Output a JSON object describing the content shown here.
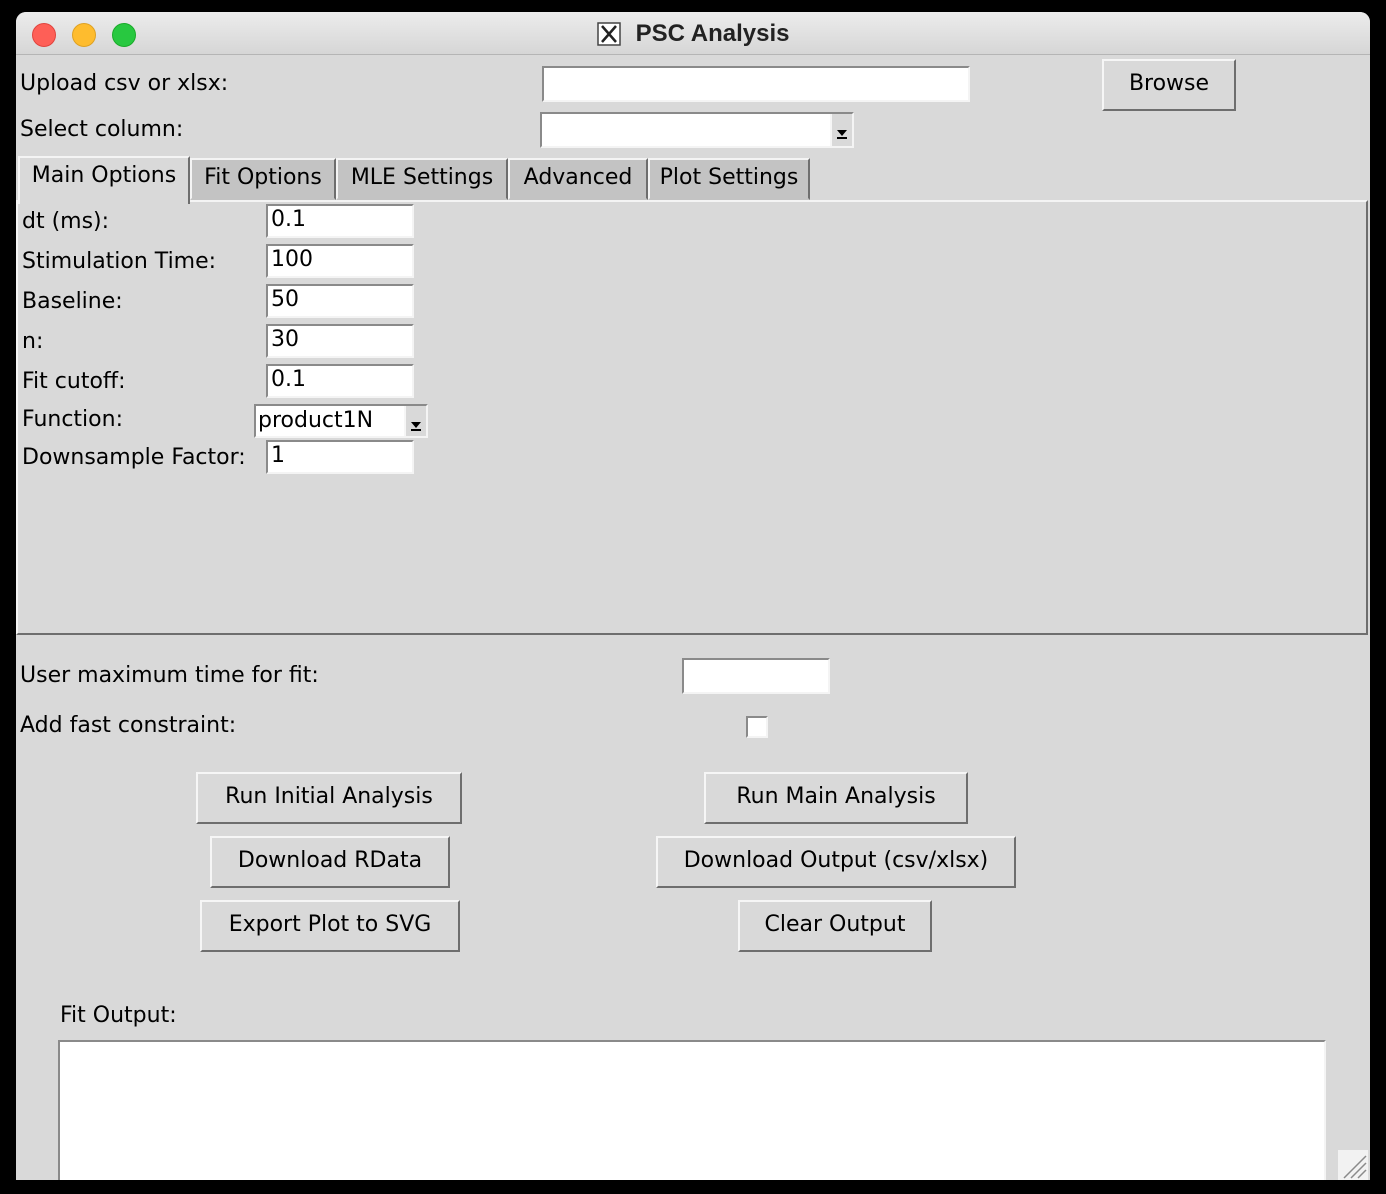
{
  "window": {
    "title": "PSC Analysis",
    "title_icon": "x11-icon"
  },
  "file": {
    "label": "Upload csv or xlsx:",
    "value": "",
    "browse_label": "Browse"
  },
  "column": {
    "label": "Select column:",
    "value": ""
  },
  "tabs": [
    {
      "label": "Main Options",
      "active": true
    },
    {
      "label": "Fit Options",
      "active": false
    },
    {
      "label": "MLE Settings",
      "active": false
    },
    {
      "label": "Advanced",
      "active": false
    },
    {
      "label": "Plot Settings",
      "active": false
    }
  ],
  "main_options": {
    "dt": {
      "label": "dt (ms):",
      "value": "0.1"
    },
    "stim_time": {
      "label": "Stimulation Time:",
      "value": "100"
    },
    "baseline": {
      "label": "Baseline:",
      "value": "50"
    },
    "n": {
      "label": "n:",
      "value": "30"
    },
    "fit_cutoff": {
      "label": "Fit cutoff:",
      "value": "0.1"
    },
    "function": {
      "label": "Function:",
      "value": "product1N"
    },
    "downsample": {
      "label": "Downsample Factor:",
      "value": "1"
    }
  },
  "user_max_time": {
    "label": "User maximum time for fit:",
    "value": ""
  },
  "fast_constraint": {
    "label": "Add fast constraint:",
    "checked": false
  },
  "buttons": {
    "run_initial": "Run Initial Analysis",
    "run_main": "Run Main Analysis",
    "download_rdata": "Download RData",
    "download_output": "Download Output (csv/xlsx)",
    "export_svg": "Export Plot to SVG",
    "clear_output": "Clear Output"
  },
  "fit_output": {
    "label": "Fit Output:",
    "value": ""
  },
  "colors": {
    "window_bg": "#d9d9d9",
    "close": "#fe5f57",
    "minimize": "#febc2e",
    "maximize": "#28c840"
  }
}
